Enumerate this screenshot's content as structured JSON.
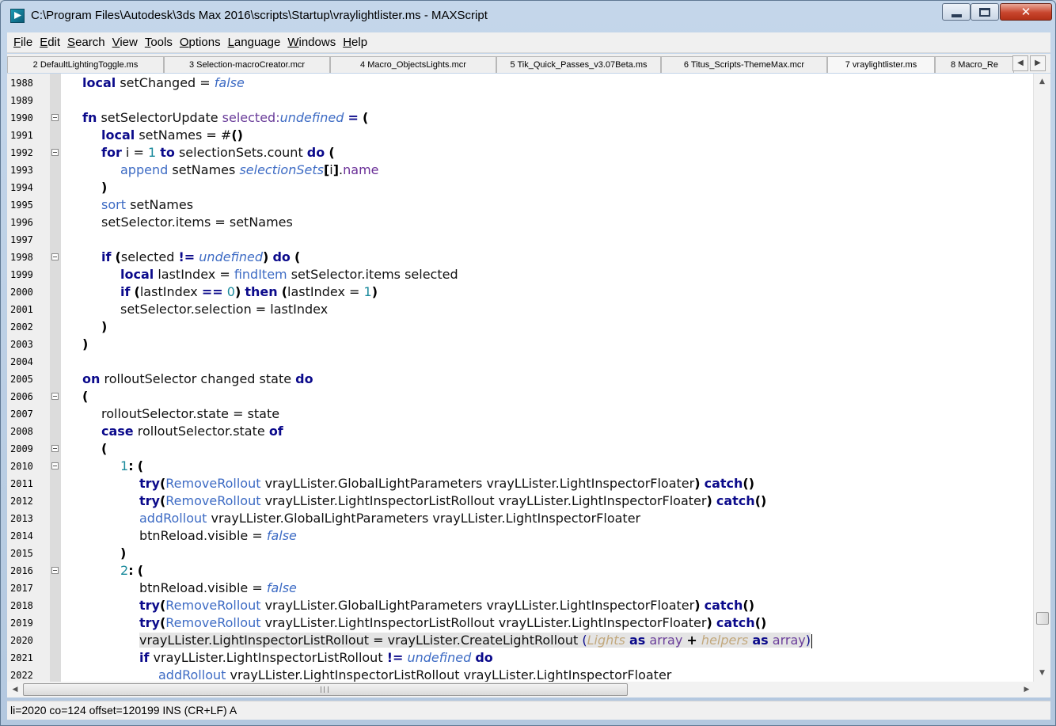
{
  "window": {
    "title": "C:\\Program Files\\Autodesk\\3ds Max 2016\\scripts\\Startup\\vraylightlister.ms - MAXScript",
    "close_glyph": "✕"
  },
  "menu": [
    "File",
    "Edit",
    "Search",
    "View",
    "Tools",
    "Options",
    "Language",
    "Windows",
    "Help"
  ],
  "tabs": [
    "2 DefaultLightingToggle.ms",
    "3 Selection-macroCreator.mcr",
    "4 Macro_ObjectsLights.mcr",
    "5 Tik_Quick_Passes_v3.07Beta.ms",
    "6 Titus_Scripts-ThemeMax.mcr",
    "7 vraylightlister.ms",
    "8 Macro_Re"
  ],
  "editor": {
    "current_line": "2020",
    "lines": [
      {
        "n": "1988",
        "fold": false,
        "indent": 0,
        "tokens": [
          [
            "kw",
            "local"
          ],
          [
            "plain",
            " setChanged = "
          ],
          [
            "lit",
            "false"
          ]
        ]
      },
      {
        "n": "1989",
        "fold": false,
        "indent": 0,
        "tokens": []
      },
      {
        "n": "1990",
        "fold": true,
        "indent": 0,
        "tokens": [
          [
            "kw",
            "fn"
          ],
          [
            "plain",
            " setSelectorUpdate "
          ],
          [
            "purp",
            "selected:"
          ],
          [
            "lit",
            "undefined"
          ],
          [
            "plain",
            " "
          ],
          [
            "kw",
            "="
          ],
          [
            "plain",
            " "
          ],
          [
            "pn",
            "("
          ]
        ]
      },
      {
        "n": "1991",
        "fold": false,
        "indent": 1,
        "tokens": [
          [
            "kw",
            "local"
          ],
          [
            "plain",
            " setNames = "
          ],
          [
            "plain",
            "#"
          ],
          [
            "pn",
            "()"
          ]
        ]
      },
      {
        "n": "1992",
        "fold": true,
        "indent": 1,
        "tokens": [
          [
            "kw",
            "for"
          ],
          [
            "plain",
            " i = "
          ],
          [
            "num",
            "1"
          ],
          [
            "plain",
            " "
          ],
          [
            "kw",
            "to"
          ],
          [
            "plain",
            " selectionSets.count "
          ],
          [
            "kw",
            "do"
          ],
          [
            "plain",
            " "
          ],
          [
            "pn",
            "("
          ]
        ]
      },
      {
        "n": "1993",
        "fold": false,
        "indent": 2,
        "tokens": [
          [
            "fn",
            "append"
          ],
          [
            "plain",
            " setNames "
          ],
          [
            "lit",
            "selectionSets"
          ],
          [
            "pn",
            "["
          ],
          [
            "plain",
            "i"
          ],
          [
            "pn",
            "]"
          ],
          [
            "plain",
            "."
          ],
          [
            "prop",
            "name"
          ]
        ]
      },
      {
        "n": "1994",
        "fold": false,
        "indent": 1,
        "tokens": [
          [
            "pn",
            ")"
          ]
        ]
      },
      {
        "n": "1995",
        "fold": false,
        "indent": 1,
        "tokens": [
          [
            "fn",
            "sort"
          ],
          [
            "plain",
            " setNames"
          ]
        ]
      },
      {
        "n": "1996",
        "fold": false,
        "indent": 1,
        "tokens": [
          [
            "plain",
            "setSelector.items = setNames"
          ]
        ]
      },
      {
        "n": "1997",
        "fold": false,
        "indent": 0,
        "tokens": []
      },
      {
        "n": "1998",
        "fold": true,
        "indent": 1,
        "tokens": [
          [
            "kw",
            "if"
          ],
          [
            "plain",
            " "
          ],
          [
            "pn",
            "("
          ],
          [
            "plain",
            "selected "
          ],
          [
            "kw",
            "!="
          ],
          [
            "plain",
            " "
          ],
          [
            "lit",
            "undefined"
          ],
          [
            "pn",
            ")"
          ],
          [
            "plain",
            " "
          ],
          [
            "kw",
            "do"
          ],
          [
            "plain",
            " "
          ],
          [
            "pn",
            "("
          ]
        ]
      },
      {
        "n": "1999",
        "fold": false,
        "indent": 2,
        "tokens": [
          [
            "kw",
            "local"
          ],
          [
            "plain",
            " lastIndex = "
          ],
          [
            "fn",
            "findItem"
          ],
          [
            "plain",
            " setSelector.items selected"
          ]
        ]
      },
      {
        "n": "2000",
        "fold": false,
        "indent": 2,
        "tokens": [
          [
            "kw",
            "if"
          ],
          [
            "plain",
            " "
          ],
          [
            "pn",
            "("
          ],
          [
            "plain",
            "lastIndex "
          ],
          [
            "kw",
            "=="
          ],
          [
            "plain",
            " "
          ],
          [
            "num",
            "0"
          ],
          [
            "pn",
            ")"
          ],
          [
            "plain",
            " "
          ],
          [
            "kw",
            "then"
          ],
          [
            "plain",
            " "
          ],
          [
            "pn",
            "("
          ],
          [
            "plain",
            "lastIndex = "
          ],
          [
            "num",
            "1"
          ],
          [
            "pn",
            ")"
          ]
        ]
      },
      {
        "n": "2001",
        "fold": false,
        "indent": 2,
        "tokens": [
          [
            "plain",
            "setSelector.selection = lastIndex"
          ]
        ]
      },
      {
        "n": "2002",
        "fold": false,
        "indent": 1,
        "tokens": [
          [
            "pn",
            ")"
          ]
        ]
      },
      {
        "n": "2003",
        "fold": false,
        "indent": 0,
        "tokens": [
          [
            "pn",
            ")"
          ]
        ]
      },
      {
        "n": "2004",
        "fold": false,
        "indent": 0,
        "tokens": []
      },
      {
        "n": "2005",
        "fold": false,
        "indent": 0,
        "tokens": [
          [
            "kw",
            "on"
          ],
          [
            "plain",
            " rolloutSelector changed state "
          ],
          [
            "kw",
            "do"
          ]
        ]
      },
      {
        "n": "2006",
        "fold": true,
        "indent": 0,
        "tokens": [
          [
            "pn",
            "("
          ]
        ]
      },
      {
        "n": "2007",
        "fold": false,
        "indent": 1,
        "tokens": [
          [
            "plain",
            "rolloutSelector.state = state"
          ]
        ]
      },
      {
        "n": "2008",
        "fold": false,
        "indent": 1,
        "tokens": [
          [
            "kw",
            "case"
          ],
          [
            "plain",
            " rolloutSelector.state "
          ],
          [
            "kw",
            "of"
          ]
        ]
      },
      {
        "n": "2009",
        "fold": true,
        "indent": 1,
        "tokens": [
          [
            "pn",
            "("
          ]
        ]
      },
      {
        "n": "2010",
        "fold": true,
        "indent": 2,
        "tokens": [
          [
            "num",
            "1"
          ],
          [
            "pn",
            ":"
          ],
          [
            "plain",
            " "
          ],
          [
            "pn",
            "("
          ]
        ]
      },
      {
        "n": "2011",
        "fold": false,
        "indent": 3,
        "tokens": [
          [
            "kw",
            "try"
          ],
          [
            "pn",
            "("
          ],
          [
            "fn",
            "RemoveRollout"
          ],
          [
            "plain",
            " vrayLLister.GlobalLightParameters vrayLLister.LightInspectorFloater"
          ],
          [
            "pn",
            ")"
          ],
          [
            "plain",
            " "
          ],
          [
            "kw",
            "catch"
          ],
          [
            "pn",
            "()"
          ]
        ]
      },
      {
        "n": "2012",
        "fold": false,
        "indent": 3,
        "tokens": [
          [
            "kw",
            "try"
          ],
          [
            "pn",
            "("
          ],
          [
            "fn",
            "RemoveRollout"
          ],
          [
            "plain",
            " vrayLLister.LightInspectorListRollout vrayLLister.LightInspectorFloater"
          ],
          [
            "pn",
            ")"
          ],
          [
            "plain",
            " "
          ],
          [
            "kw",
            "catch"
          ],
          [
            "pn",
            "()"
          ]
        ]
      },
      {
        "n": "2013",
        "fold": false,
        "indent": 3,
        "tokens": [
          [
            "fn",
            "addRollout"
          ],
          [
            "plain",
            " vrayLLister.GlobalLightParameters vrayLLister.LightInspectorFloater"
          ]
        ]
      },
      {
        "n": "2014",
        "fold": false,
        "indent": 3,
        "tokens": [
          [
            "plain",
            "btnReload.visible = "
          ],
          [
            "lit",
            "false"
          ]
        ]
      },
      {
        "n": "2015",
        "fold": false,
        "indent": 2,
        "tokens": [
          [
            "pn",
            ")"
          ]
        ]
      },
      {
        "n": "2016",
        "fold": true,
        "indent": 2,
        "tokens": [
          [
            "num",
            "2"
          ],
          [
            "pn",
            ":"
          ],
          [
            "plain",
            " "
          ],
          [
            "pn",
            "("
          ]
        ]
      },
      {
        "n": "2017",
        "fold": false,
        "indent": 3,
        "tokens": [
          [
            "plain",
            "btnReload.visible = "
          ],
          [
            "lit",
            "false"
          ]
        ]
      },
      {
        "n": "2018",
        "fold": false,
        "indent": 3,
        "tokens": [
          [
            "kw",
            "try"
          ],
          [
            "pn",
            "("
          ],
          [
            "fn",
            "RemoveRollout"
          ],
          [
            "plain",
            " vrayLLister.GlobalLightParameters vrayLLister.LightInspectorFloater"
          ],
          [
            "pn",
            ")"
          ],
          [
            "plain",
            " "
          ],
          [
            "kw",
            "catch"
          ],
          [
            "pn",
            "()"
          ]
        ]
      },
      {
        "n": "2019",
        "fold": false,
        "indent": 3,
        "tokens": [
          [
            "kw",
            "try"
          ],
          [
            "pn",
            "("
          ],
          [
            "fn",
            "RemoveRollout"
          ],
          [
            "plain",
            " vrayLLister.LightInspectorListRollout vrayLLister.LightInspectorFloater"
          ],
          [
            "pn",
            ")"
          ],
          [
            "plain",
            " "
          ],
          [
            "kw",
            "catch"
          ],
          [
            "pn",
            "()"
          ]
        ]
      },
      {
        "n": "2020",
        "fold": false,
        "indent": 3,
        "tokens": [
          [
            "plain",
            "vrayLLister.LightInspectorListRollout = vrayLLister.CreateLightRollout "
          ],
          [
            "kwl",
            "("
          ],
          [
            "gry",
            "Lights"
          ],
          [
            "plain",
            " "
          ],
          [
            "kw",
            "as"
          ],
          [
            "plain",
            " "
          ],
          [
            "purp",
            "array"
          ],
          [
            "plain",
            " "
          ],
          [
            "pn",
            "+"
          ],
          [
            "plain",
            " "
          ],
          [
            "gry",
            "helpers"
          ],
          [
            "plain",
            " "
          ],
          [
            "kw",
            "as"
          ],
          [
            "plain",
            " "
          ],
          [
            "purp",
            "array"
          ],
          [
            "kwl",
            ")"
          ]
        ]
      },
      {
        "n": "2021",
        "fold": false,
        "indent": 3,
        "tokens": [
          [
            "kw",
            "if"
          ],
          [
            "plain",
            " vrayLLister.LightInspectorListRollout "
          ],
          [
            "kw",
            "!="
          ],
          [
            "plain",
            " "
          ],
          [
            "lit",
            "undefined"
          ],
          [
            "plain",
            " "
          ],
          [
            "kw",
            "do"
          ]
        ]
      },
      {
        "n": "2022",
        "fold": false,
        "indent": 4,
        "tokens": [
          [
            "fn",
            "addRollout"
          ],
          [
            "plain",
            " vrayLLister.LightInspectorListRollout vrayLLister.LightInspectorFloater"
          ]
        ]
      }
    ]
  },
  "status": {
    "text": "li=2020 co=124 offset=120199 INS (CR+LF) A"
  }
}
